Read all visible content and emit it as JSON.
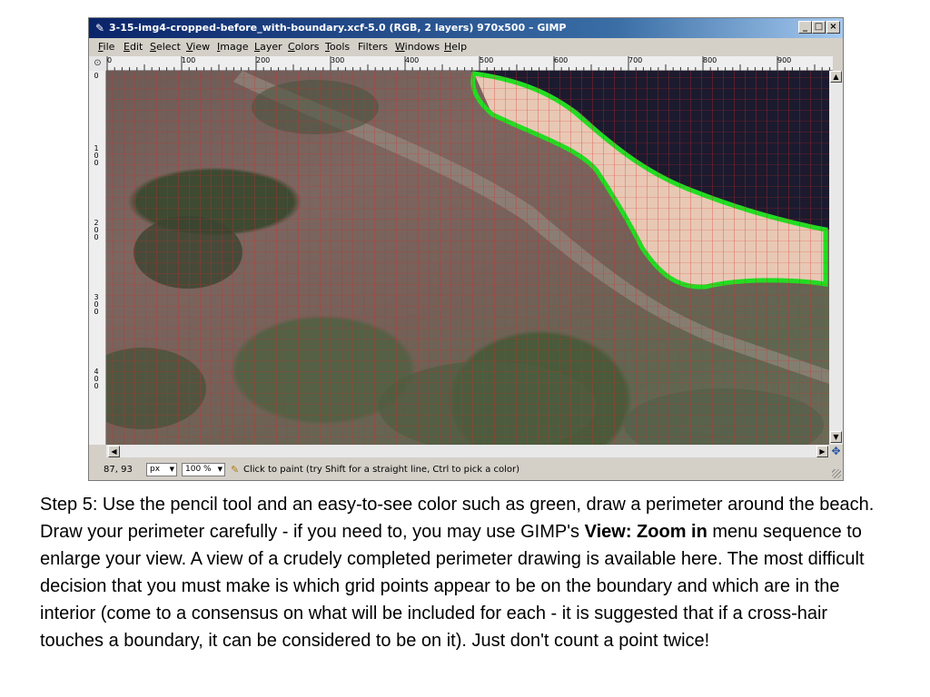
{
  "window": {
    "title": "3-15-img4-cropped-before_with-boundary.xcf-5.0 (RGB, 2 layers) 970x500 – GIMP",
    "controls": [
      "_",
      "□",
      "×"
    ]
  },
  "menubar": [
    {
      "label": "File",
      "ul": "F",
      "rest": "ile"
    },
    {
      "label": "Edit",
      "ul": "E",
      "rest": "dit"
    },
    {
      "label": "Select",
      "ul": "S",
      "rest": "elect"
    },
    {
      "label": "View",
      "ul": "V",
      "rest": "iew"
    },
    {
      "label": "Image",
      "ul": "I",
      "rest": "mage"
    },
    {
      "label": "Layer",
      "ul": "L",
      "rest": "ayer"
    },
    {
      "label": "Colors",
      "ul": "C",
      "rest": "olors"
    },
    {
      "label": "Tools",
      "ul": "T",
      "rest": "ools"
    },
    {
      "label": "Filters",
      "ul": "",
      "rest": "Filters"
    },
    {
      "label": "Windows",
      "ul": "W",
      "rest": "indows"
    },
    {
      "label": "Help",
      "ul": "H",
      "rest": "elp"
    }
  ],
  "ruler": {
    "top_labels": [
      "0",
      "100",
      "200",
      "300",
      "400",
      "500",
      "600",
      "700",
      "800",
      "900"
    ],
    "left_labels": [
      "0",
      "1\n0\n0",
      "2\n0\n0",
      "3\n0\n0",
      "4\n0\n0"
    ]
  },
  "statusbar": {
    "coords": "87, 93",
    "unit": "px",
    "zoom": "100 %",
    "message": "Click to paint (try Shift for a straight line, Ctrl to pick a color)"
  },
  "caption": {
    "part1": "Step 5: Use the pencil tool and an easy-to-see color such as green, draw a perimeter around the beach. Draw your perimeter carefully - if you need to, you may use GIMP's ",
    "bold": "View: Zoom in",
    "part2": " menu sequence to enlarge your view. A view of a crudely completed perimeter drawing is available here. The most difficult decision that you must make is which grid points appear to be on the boundary and which are in the interior (come to a consensus on what will be included for each - it is suggested that if a cross-hair touches a boundary, it can be considered to be on it). Just don't count a point twice!"
  },
  "colors": {
    "boundary": "#22dd22",
    "beach": "#e8c8b4",
    "sea": "#1c1a2e",
    "grid": "#dd2828"
  }
}
